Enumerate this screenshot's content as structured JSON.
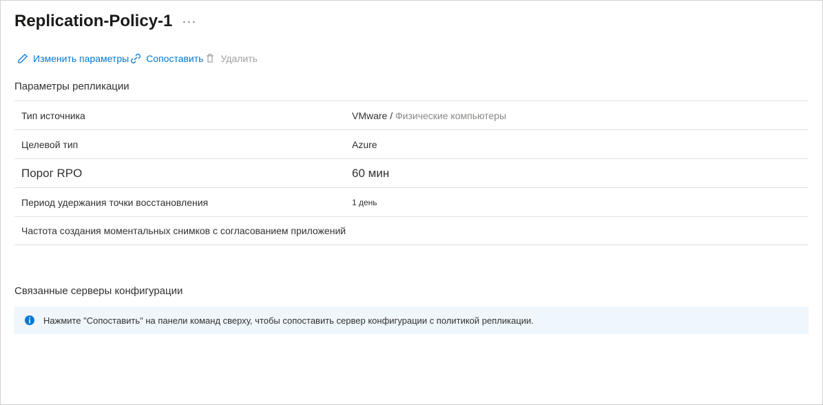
{
  "header": {
    "title": "Replication-Policy-1",
    "overflow": "···"
  },
  "toolbar": {
    "edit": "Изменить параметры",
    "associate": "Сопоставить",
    "delete": "Удалить"
  },
  "section1": {
    "title": "Параметры репликации",
    "rows": {
      "sourceType": {
        "label": "Тип источника",
        "value_strong": "VMware /",
        "value_rest": " Физические компьютеры"
      },
      "targetType": {
        "label": "Целевой тип",
        "value": "Azure"
      },
      "rpo": {
        "label": "Порог RPO",
        "value": "60 мин"
      },
      "retention": {
        "label": "Период удержания точки восстановления",
        "value": "1 день"
      },
      "snapshotFreq": {
        "label": "Частота создания моментальных снимков с согласованием приложений",
        "value": ""
      }
    }
  },
  "section2": {
    "title": "Связанные серверы конфигурации",
    "info": "Нажмите \"Сопоставить\" на панели команд сверху, чтобы сопоставить сервер конфигурации с политикой репликации."
  }
}
